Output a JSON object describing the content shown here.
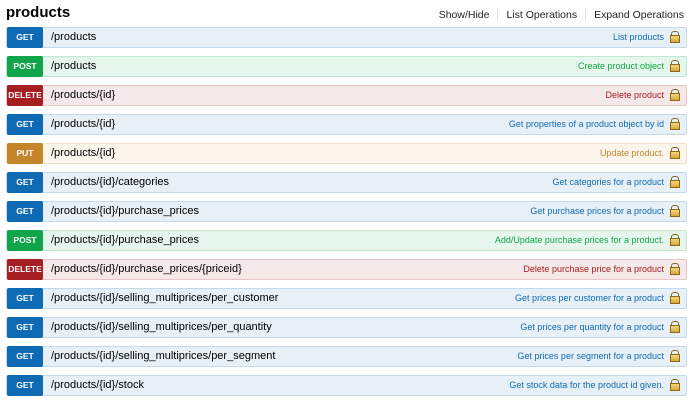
{
  "section": {
    "title": "products",
    "links": [
      "Show/Hide",
      "List Operations",
      "Expand Operations"
    ]
  },
  "operations": [
    {
      "method": "GET",
      "path": "/products",
      "summary": "List products"
    },
    {
      "method": "POST",
      "path": "/products",
      "summary": "Create product object"
    },
    {
      "method": "DELETE",
      "path": "/products/{id}",
      "summary": "Delete product"
    },
    {
      "method": "GET",
      "path": "/products/{id}",
      "summary": "Get properties of a product object by id"
    },
    {
      "method": "PUT",
      "path": "/products/{id}",
      "summary": "Update product."
    },
    {
      "method": "GET",
      "path": "/products/{id}/categories",
      "summary": "Get categories for a product"
    },
    {
      "method": "GET",
      "path": "/products/{id}/purchase_prices",
      "summary": "Get purchase prices for a product"
    },
    {
      "method": "POST",
      "path": "/products/{id}/purchase_prices",
      "summary": "Add/Update purchase prices for a product."
    },
    {
      "method": "DELETE",
      "path": "/products/{id}/purchase_prices/{priceid}",
      "summary": "Delete purchase price for a product"
    },
    {
      "method": "GET",
      "path": "/products/{id}/selling_multiprices/per_customer",
      "summary": "Get prices per customer for a product"
    },
    {
      "method": "GET",
      "path": "/products/{id}/selling_multiprices/per_quantity",
      "summary": "Get prices per quantity for a product"
    },
    {
      "method": "GET",
      "path": "/products/{id}/selling_multiprices/per_segment",
      "summary": "Get prices per segment for a product"
    },
    {
      "method": "GET",
      "path": "/products/{id}/stock",
      "summary": "Get stock data for the product id given."
    }
  ],
  "colors": {
    "get": "#0f6ab4",
    "post": "#10a54a",
    "delete": "#a41e22",
    "put": "#c5862b"
  },
  "icons": {
    "auth": "lock-icon"
  }
}
